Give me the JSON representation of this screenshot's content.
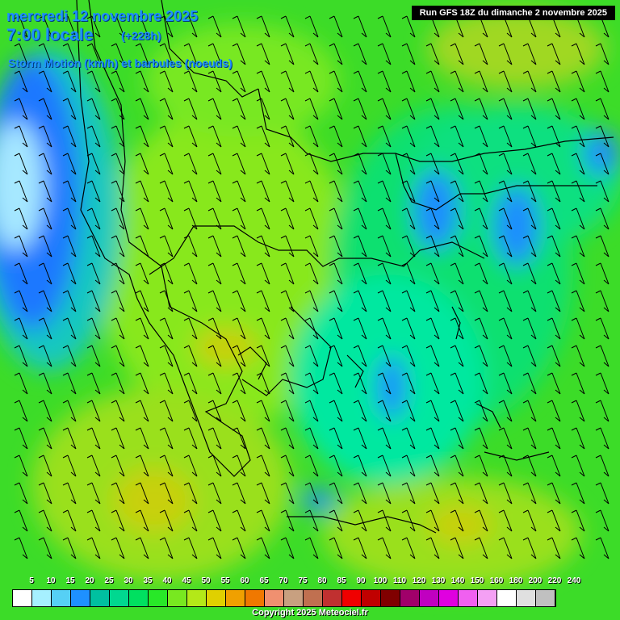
{
  "header": {
    "date": "mercredi 12 novembre 2025",
    "time": "7:00 locale",
    "lead": "(+228h)",
    "parameter": "Storm Motion (km/h) et barbules (noeuds)",
    "run": "Run GFS 18Z du dimanche 2 novembre 2025"
  },
  "legend": {
    "labels": [
      "5",
      "10",
      "15",
      "20",
      "25",
      "30",
      "35",
      "40",
      "45",
      "50",
      "55",
      "60",
      "65",
      "70",
      "75",
      "80",
      "85",
      "90",
      "100",
      "110",
      "120",
      "130",
      "140",
      "150",
      "160",
      "180",
      "200",
      "220",
      "240"
    ],
    "colors": [
      "#ffffff",
      "#a6f0ff",
      "#56d0f5",
      "#1e90ff",
      "#00c0a0",
      "#00d890",
      "#00e060",
      "#28e828",
      "#78e820",
      "#b4e818",
      "#e0d000",
      "#f0a000",
      "#f07800",
      "#f09070",
      "#c8a080",
      "#c07050",
      "#c03030",
      "#f00000",
      "#c00000",
      "#800000",
      "#a0006a",
      "#c000c0",
      "#e000e0",
      "#f060f0",
      "#f4a0f4",
      "#ffffff",
      "#e0e0e0",
      "#c0c0c0"
    ]
  },
  "copyright": "Copyright 2025 Meteociel.fr"
}
